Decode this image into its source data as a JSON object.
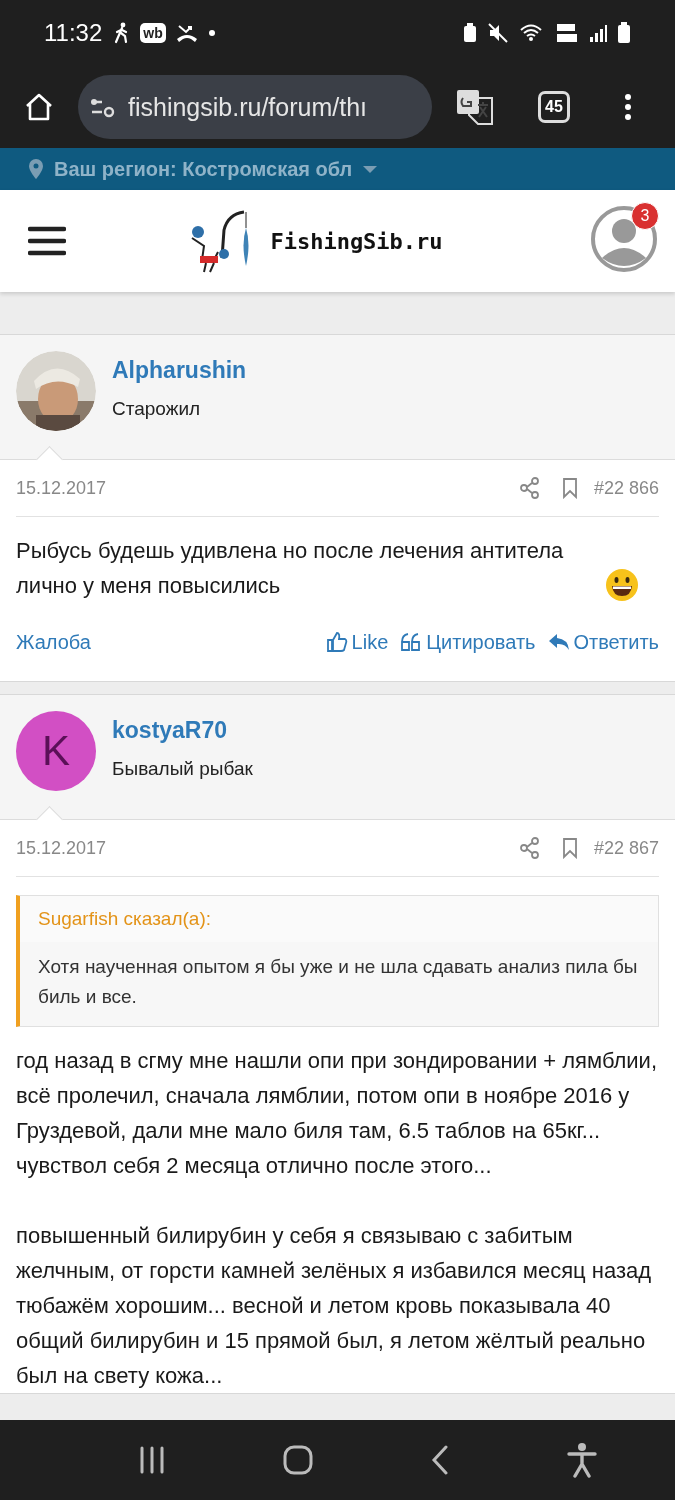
{
  "status_bar": {
    "time": "11:32",
    "app_badge": "wb"
  },
  "browser": {
    "url": "fishingsib.ru/forum/thı",
    "tab_count": "45"
  },
  "region_bar": {
    "label": "Ваш регион: Костромская обл"
  },
  "site_header": {
    "logo_text": "FishingSib.ru",
    "notification_count": "3"
  },
  "posts": [
    {
      "author": "Alpharushin",
      "rank": "Старожил",
      "avatar": {
        "kind": "picture"
      },
      "date": "15.12.2017",
      "number": "#22 866",
      "paragraphs": [
        "Рыбусь будешь удивлена но после лечения антитела лично у меня повысились"
      ],
      "emoji": true,
      "actions": {
        "report": "Жалоба",
        "like": "Like",
        "quote": "Цитировать",
        "reply": "Ответить"
      }
    },
    {
      "author": "kostyaR70",
      "rank": "Бывалый рыбак",
      "avatar": {
        "kind": "letter",
        "letter": "K",
        "color": "#d24fc4"
      },
      "date": "15.12.2017",
      "number": "#22 867",
      "quote": {
        "source": "Sugarfish сказал(а):",
        "text": "Хотя наученная опытом я бы уже и не шла сдавать анализ пила бы биль и все."
      },
      "paragraphs": [
        "год назад в сгму мне нашли опи при зондировании + лямблии, всё пролечил, сначала лямблии, потом опи в ноябре 2016 у Груздевой, дали мне мало биля там, 6.5 таблов на 65кг... чувствол себя 2 месяца отлично после этого...",
        "повышенный билирубин у себя я связываю с забитым желчным, от горсти камней зелёных я избавился месяц назад тюбажём хорошим... весной и летом кровь показывала 40 общий билирубин и 15 прямой был, я летом жёлтый реально был на свету кожа..."
      ],
      "emoji": false
    }
  ]
}
